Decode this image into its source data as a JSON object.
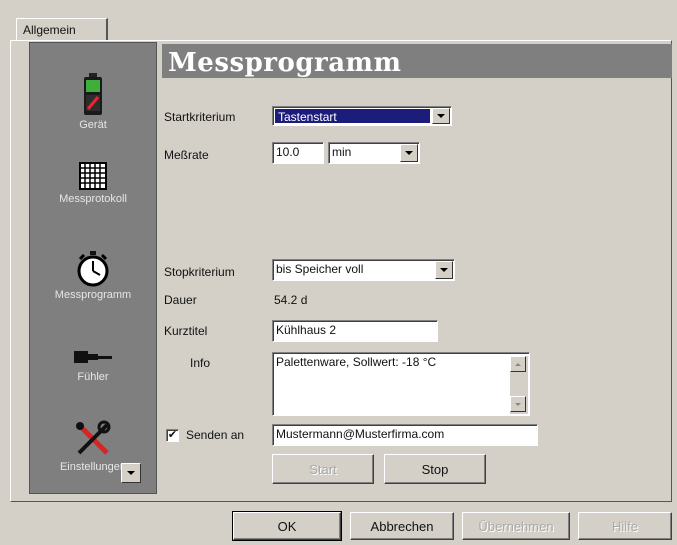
{
  "tabs": [
    {
      "label": "Allgemein"
    }
  ],
  "sidebar": {
    "items": [
      {
        "label": "Gerät",
        "icon": "device-icon"
      },
      {
        "label": "Messprotokoll",
        "icon": "grid-icon"
      },
      {
        "label": "Messprogramm",
        "icon": "stopwatch-icon"
      },
      {
        "label": "Fühler",
        "icon": "sensor-probe-icon"
      },
      {
        "label": "Einstellungen",
        "icon": "tools-icon"
      }
    ]
  },
  "main": {
    "title": "Messprogramm",
    "startkriterium": {
      "label": "Startkriterium",
      "value": "Tastenstart"
    },
    "messrate": {
      "label": "Meßrate",
      "value": "10.0",
      "unit": "min"
    },
    "stopkriterium": {
      "label": "Stopkriterium",
      "value": "bis Speicher voll"
    },
    "dauer": {
      "label": "Dauer",
      "value": "54.2 d"
    },
    "kurztitel": {
      "label": "Kurztitel",
      "value": "Kühlhaus 2"
    },
    "info": {
      "label": "Info",
      "value": "Palettenware, Sollwert: -18 °C"
    },
    "senden": {
      "label": "Senden an",
      "checked": true,
      "check_mark": "✔",
      "value": "Mustermann@Musterfirma.com"
    },
    "start_button": "Start",
    "stop_button": "Stop"
  },
  "footer": {
    "ok": "OK",
    "cancel": "Abbrechen",
    "apply": "Übernehmen",
    "help": "Hilfe"
  },
  "colors": {
    "dialog_bg": "#d4d0c8",
    "sidebar_bg": "#7f7f7f",
    "heading_bg": "#7f7f7f",
    "selection": "#1c1c7a"
  }
}
